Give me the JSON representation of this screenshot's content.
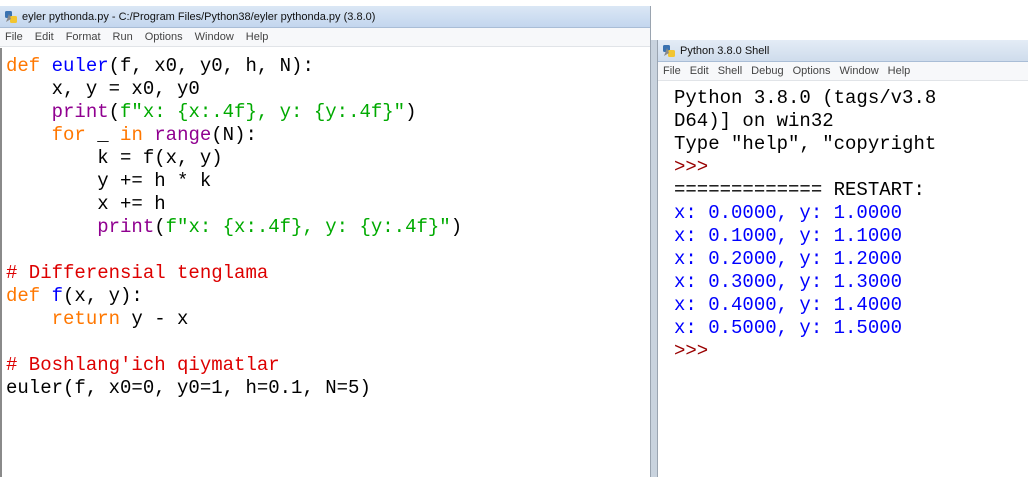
{
  "editor": {
    "title": "eyler pythonda.py - C:/Program Files/Python38/eyler pythonda.py (3.8.0)",
    "menu": [
      "File",
      "Edit",
      "Format",
      "Run",
      "Options",
      "Window",
      "Help"
    ],
    "code_lines": [
      [
        [
          "kw",
          "def "
        ],
        [
          "fn",
          "euler"
        ],
        [
          "",
          "(f, x0, y0, h, N):"
        ]
      ],
      [
        [
          "",
          "    x, y = x0, y0"
        ]
      ],
      [
        [
          "bi",
          "    print"
        ],
        [
          "",
          "("
        ],
        [
          "str",
          "f\"x: {x:.4f}, y: {y:.4f}\""
        ],
        [
          "",
          ")"
        ]
      ],
      [
        [
          "kw",
          "    for"
        ],
        [
          "",
          " _ "
        ],
        [
          "kw",
          "in "
        ],
        [
          "bi",
          "range"
        ],
        [
          "",
          "(N):"
        ]
      ],
      [
        [
          "",
          "        k = f(x, y)"
        ]
      ],
      [
        [
          "",
          "        y += h * k"
        ]
      ],
      [
        [
          "",
          "        x += h"
        ]
      ],
      [
        [
          "bi",
          "        print"
        ],
        [
          "",
          "("
        ],
        [
          "str",
          "f\"x: {x:.4f}, y: {y:.4f}\""
        ],
        [
          "",
          ")"
        ]
      ],
      [
        [
          "",
          ""
        ]
      ],
      [
        [
          "cm",
          "# Differensial tenglama"
        ]
      ],
      [
        [
          "kw",
          "def "
        ],
        [
          "fn",
          "f"
        ],
        [
          "",
          "(x, y):"
        ]
      ],
      [
        [
          "kw",
          "    return"
        ],
        [
          "",
          " y - x"
        ]
      ],
      [
        [
          "",
          ""
        ]
      ],
      [
        [
          "cm",
          "# Boshlang'ich qiymatlar"
        ]
      ],
      [
        [
          "",
          "euler(f, x0=0, y0=1, h=0.1, N=5)"
        ]
      ]
    ]
  },
  "shell": {
    "title": "Python 3.8.0 Shell",
    "menu": [
      "File",
      "Edit",
      "Shell",
      "Debug",
      "Options",
      "Window",
      "Help"
    ],
    "lines": [
      [
        [
          "",
          "Python 3.8.0 (tags/v3.8"
        ]
      ],
      [
        [
          "",
          "D64)] on win32"
        ]
      ],
      [
        [
          "",
          "Type \"help\", \"copyright"
        ]
      ],
      [
        [
          "prompt",
          ">>>"
        ]
      ],
      [
        [
          "",
          "============= RESTART:"
        ]
      ],
      [
        [
          "out",
          "x: 0.0000, y: 1.0000"
        ]
      ],
      [
        [
          "out",
          "x: 0.1000, y: 1.1000"
        ]
      ],
      [
        [
          "out",
          "x: 0.2000, y: 1.2000"
        ]
      ],
      [
        [
          "out",
          "x: 0.3000, y: 1.3000"
        ]
      ],
      [
        [
          "out",
          "x: 0.4000, y: 1.4000"
        ]
      ],
      [
        [
          "out",
          "x: 0.5000, y: 1.5000"
        ]
      ],
      [
        [
          "prompt",
          ">>>"
        ]
      ]
    ]
  },
  "colors": {
    "keyword": "#ff7700",
    "function_name": "#0000ff",
    "string": "#00aa00",
    "builtin": "#900090",
    "comment": "#dd0000",
    "output": "#0000ff",
    "prompt": "#990000"
  },
  "icons": {
    "editor_app_icon": "python-icon",
    "shell_app_icon": "python-icon"
  }
}
